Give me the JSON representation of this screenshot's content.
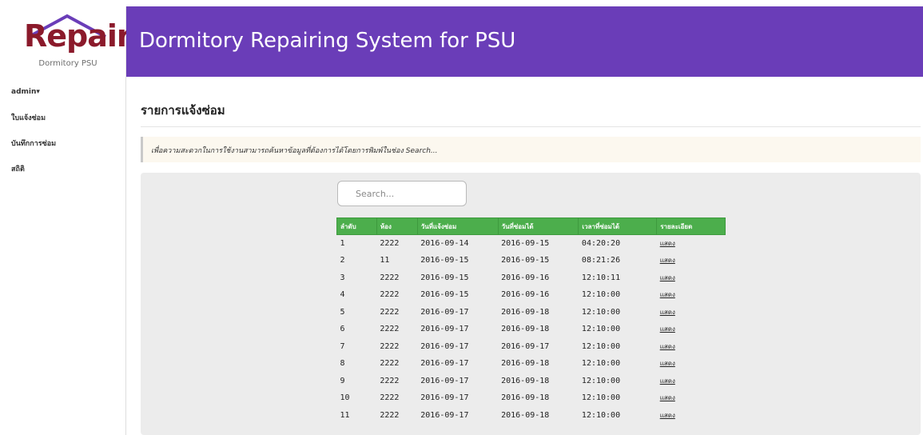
{
  "logo": {
    "text": "Repair",
    "subtitle": "Dormitory PSU",
    "color": "#8b1a2b"
  },
  "header": {
    "title": "Dormitory Repairing System for PSU",
    "color": "#6a3db8"
  },
  "sidebar": {
    "items": [
      {
        "label": "admin▾"
      },
      {
        "label": "ใบแจ้งซ่อม"
      },
      {
        "label": "บันทึกการซ่อม"
      },
      {
        "label": "สถิติ"
      }
    ]
  },
  "main": {
    "title": "รายการแจ้งซ่อม",
    "notice": "เพื่อความสะดวกในการใช้งานสามารถค้นหาข้อมูลที่ต้องการได้โดยการพิมพ์ในช่อง Search...",
    "search": {
      "placeholder": "Search...",
      "value": ""
    },
    "table": {
      "header_color": "#4cae4c",
      "columns": [
        "ลำดับ",
        "ห้อง",
        "วันที่แจ้งซ่อม",
        "วันที่ซ่อมได้",
        "เวลาที่ซ่อมได้",
        "รายละเอียด"
      ],
      "rows": [
        [
          "1",
          "2222",
          "2016-09-14",
          "2016-09-15",
          "04:20:20",
          "แสดง"
        ],
        [
          "2",
          "11",
          "2016-09-15",
          "2016-09-15",
          "08:21:26",
          "แสดง"
        ],
        [
          "3",
          "2222",
          "2016-09-15",
          "2016-09-16",
          "12:10:11",
          "แสดง"
        ],
        [
          "4",
          "2222",
          "2016-09-15",
          "2016-09-16",
          "12:10:00",
          "แสดง"
        ],
        [
          "5",
          "2222",
          "2016-09-17",
          "2016-09-18",
          "12:10:00",
          "แสดง"
        ],
        [
          "6",
          "2222",
          "2016-09-17",
          "2016-09-18",
          "12:10:00",
          "แสดง"
        ],
        [
          "7",
          "2222",
          "2016-09-17",
          "2016-09-17",
          "12:10:00",
          "แสดง"
        ],
        [
          "8",
          "2222",
          "2016-09-17",
          "2016-09-18",
          "12:10:00",
          "แสดง"
        ],
        [
          "9",
          "2222",
          "2016-09-17",
          "2016-09-18",
          "12:10:00",
          "แสดง"
        ],
        [
          "10",
          "2222",
          "2016-09-17",
          "2016-09-18",
          "12:10:00",
          "แสดง"
        ],
        [
          "11",
          "2222",
          "2016-09-17",
          "2016-09-18",
          "12:10:00",
          "แสดง"
        ]
      ]
    }
  }
}
